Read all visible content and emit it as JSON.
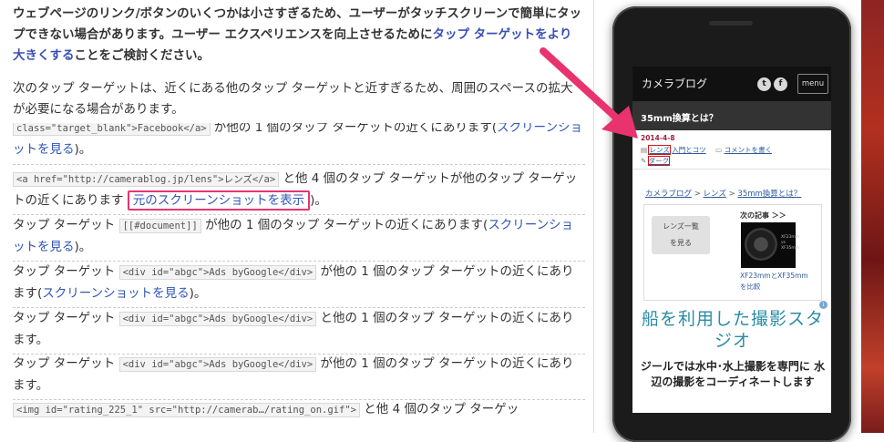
{
  "intro": {
    "text_before": "ウェブページのリンク/ボタンのいくつかは小さすぎるため、ユーザーがタッチスクリーンで簡単にタップできない場合があります。ユーザー エクスペリエンスを向上させるために",
    "link": "タップ ターゲットをより大きくする",
    "text_after": "ことをご検討ください。"
  },
  "subheading": "次のタップ ターゲットは、近くにある他のタップ ターゲットと近すぎるため、周囲のスペースの拡大が必要になる場合があります。",
  "items": [
    {
      "code": "class=\"target_blank\">Facebook</a>",
      "text": "が他の 1 個のタップ ターゲットの近くにあります(",
      "link": "スクリーンショットを見る",
      "end": ")。"
    },
    {
      "code": "<a href=\"http://camerablog.jp/lens\">レンズ</a>",
      "text": "と他 4 個のタップ ターゲットが他のタップ ターゲットの近くにあります",
      "link": "元のスクリーンショットを表示",
      "end": ")。"
    },
    {
      "prefix": "タップ ターゲット",
      "code": "[[#document]]",
      "text": "が他の 1 個のタップ ターゲットの近くにあります(",
      "link": "スクリーンショットを見る",
      "end": ")。"
    },
    {
      "prefix": "タップ ターゲット",
      "code": "<div id=\"abgc\">Ads byGoogle</div>",
      "text": "が他の 1 個のタップ ターゲットの近くにあります(",
      "link": "スクリーンショットを見る",
      "end": ")。"
    },
    {
      "prefix": "タップ ターゲット",
      "code": "<div id=\"abgc\">Ads byGoogle</div>",
      "text": "と他の 1 個のタップ ターゲットの近くにあります。"
    },
    {
      "prefix": "タップ ターゲット",
      "code": "<div id=\"abgc\">Ads byGoogle</div>",
      "text": "が他の 1 個のタップ ターゲットの近くにあります。"
    },
    {
      "code": "<img id=\"rating_225_1\" src=\"http://camerab…/rating_on.gif\">",
      "text": "と他 4 個のタップ ターゲッ"
    }
  ],
  "phone": {
    "site_title": "カメラブログ",
    "twitter_icon": "t",
    "facebook_icon": "f",
    "menu_label": "menu",
    "post_title": "35mm換算とは？",
    "date": "2014-4-8",
    "cat_lens": "レンズ",
    "cat_tips": "入門とコツ",
    "comment_link": "コメントを書く",
    "tag_dark": "ダーク",
    "breadcrumb": [
      "カメラブログ",
      "レンズ",
      "35mm換算とは？"
    ],
    "breadcrumb_sep": ">",
    "lens_list_btn": [
      "レンズ一覧",
      "を見る"
    ],
    "next_post_label": "次の記事 ＞＞",
    "next_post_caption": [
      "XF23mmとXF35mm",
      "を比較"
    ],
    "thumb_text": [
      "XF23mm",
      "vs",
      "XF35mm"
    ],
    "ad_headline": "船を利用した撮影スタジオ",
    "ad_body": "ジールでは水中･水上撮影を専門に 水辺の撮影をコーディネートします",
    "ad_badge": "i"
  },
  "colors": {
    "link": "#2f56b5",
    "highlight_box": "#e8336f",
    "arrow": "#e8336f",
    "date": "#a0213c"
  }
}
